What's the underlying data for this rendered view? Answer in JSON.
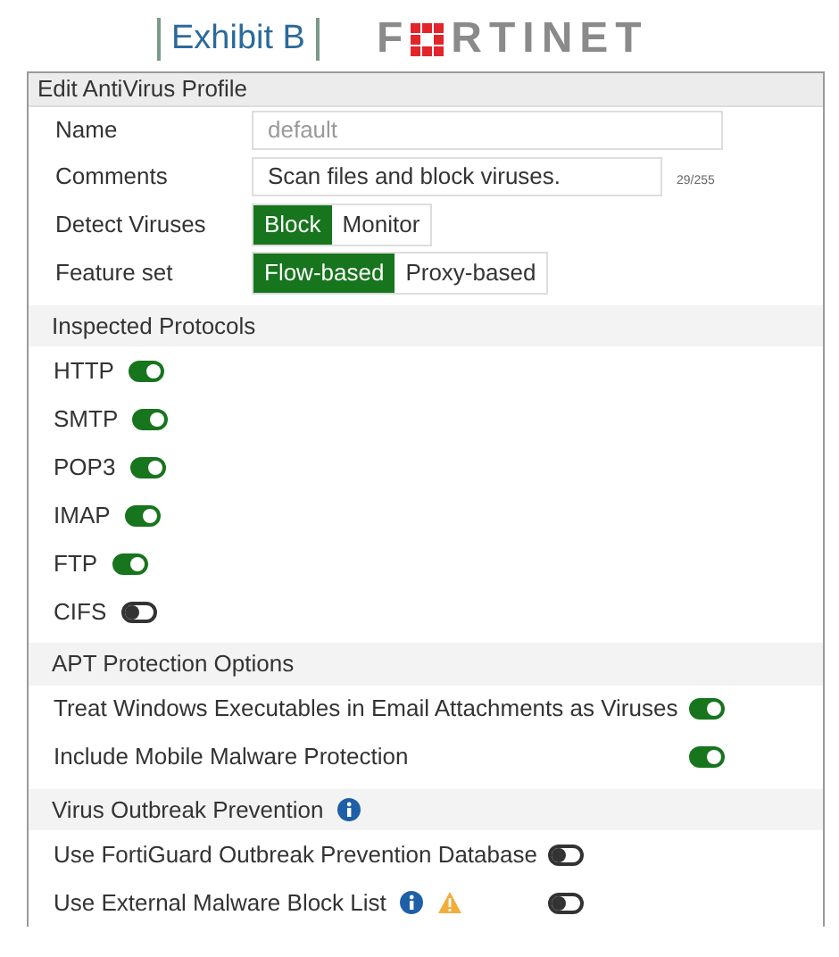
{
  "header": {
    "exhibit": "Exhibit B",
    "logo_start": "F",
    "logo_end": "RTINET"
  },
  "panel": {
    "title": "Edit AntiVirus Profile",
    "name": {
      "label": "Name",
      "value": "default",
      "disabled": true
    },
    "comments": {
      "label": "Comments",
      "value": "Scan files and block viruses.",
      "counter": "29/255"
    },
    "detect_viruses": {
      "label": "Detect Viruses",
      "options": [
        {
          "label": "Block",
          "selected": true
        },
        {
          "label": "Monitor",
          "selected": false
        }
      ]
    },
    "feature_set": {
      "label": "Feature set",
      "options": [
        {
          "label": "Flow-based",
          "selected": true
        },
        {
          "label": "Proxy-based",
          "selected": false
        }
      ]
    },
    "sections": [
      {
        "title": "Inspected Protocols",
        "kind": "inline",
        "items": [
          {
            "label": "HTTP",
            "on": true
          },
          {
            "label": "SMTP",
            "on": true
          },
          {
            "label": "POP3",
            "on": true
          },
          {
            "label": "IMAP",
            "on": true
          },
          {
            "label": "FTP",
            "on": true
          },
          {
            "label": "CIFS",
            "on": false
          }
        ]
      },
      {
        "title": "APT Protection Options",
        "kind": "aligned",
        "items": [
          {
            "label": "Treat Windows Executables in Email Attachments as Viruses",
            "on": true
          },
          {
            "label": "Include Mobile Malware Protection",
            "on": true
          }
        ]
      },
      {
        "title": "Virus Outbreak Prevention",
        "info": true,
        "kind": "aligned",
        "items": [
          {
            "label": "Use FortiGuard Outbreak Prevention Database",
            "on": false
          },
          {
            "label": "Use External Malware Block List",
            "info": true,
            "warning": true,
            "on": false
          }
        ]
      }
    ]
  }
}
